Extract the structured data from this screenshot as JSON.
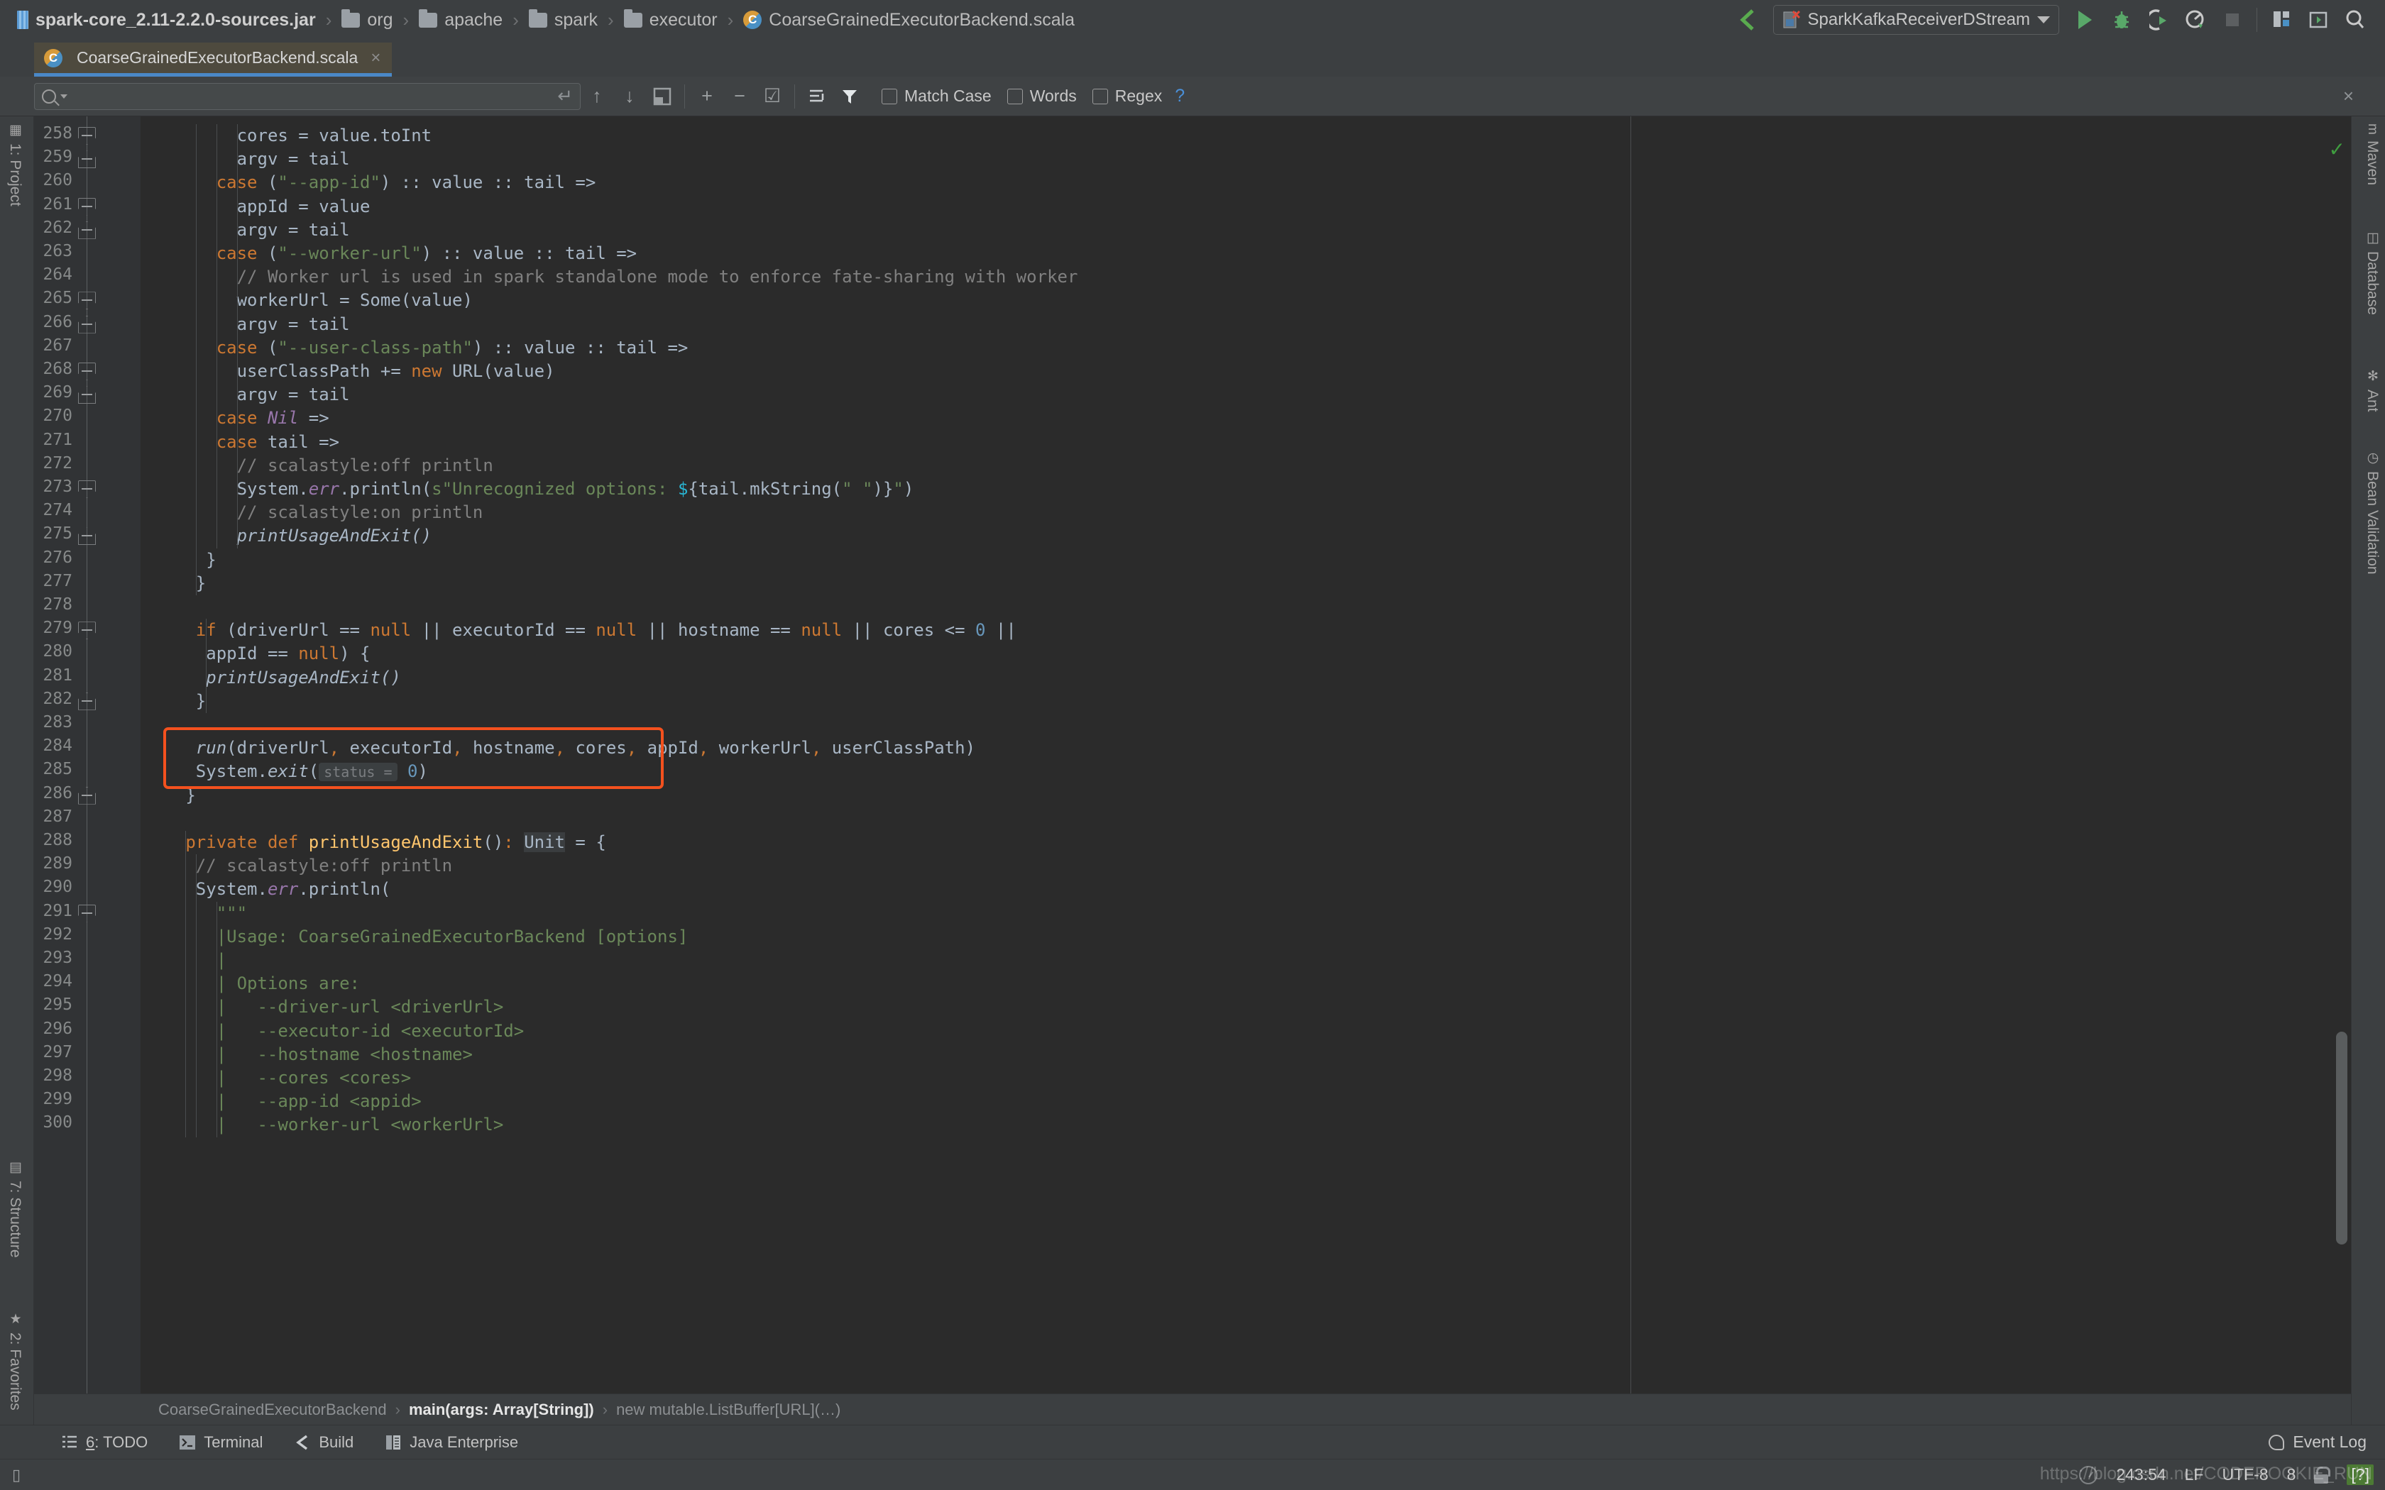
{
  "window": {
    "breadcrumbs": [
      {
        "icon": "jar-icon",
        "label": "spark-core_2.11-2.2.0-sources.jar",
        "bold": true
      },
      {
        "icon": "folder-icon",
        "label": "org",
        "bold": false
      },
      {
        "icon": "folder-icon",
        "label": "apache",
        "bold": false
      },
      {
        "icon": "folder-icon",
        "label": "spark",
        "bold": false
      },
      {
        "icon": "folder-icon",
        "label": "executor",
        "bold": false
      },
      {
        "icon": "scala-file-icon",
        "label": "CoarseGrainedExecutorBackend.scala",
        "bold": false
      }
    ]
  },
  "toolbar": {
    "back_icon": "checkmark-chevron-icon",
    "run_configuration": "SparkKafkaReceiverDStream",
    "icons": [
      {
        "name": "run-icon",
        "glyph": "▶"
      },
      {
        "name": "debug-icon",
        "glyph": "✶"
      },
      {
        "name": "run-with-coverage-icon",
        "glyph": "◗"
      },
      {
        "name": "profile-icon",
        "glyph": "◷"
      },
      {
        "name": "stop-icon",
        "glyph": "■"
      },
      {
        "name": "project-structure-icon",
        "glyph": "▤"
      },
      {
        "name": "terminal-icon",
        "glyph": "▣"
      },
      {
        "name": "search-everywhere-icon",
        "glyph": "⌕"
      }
    ]
  },
  "tabs": [
    {
      "label": "CoarseGrainedExecutorBackend.scala",
      "icon": "scala-file-icon",
      "active": true,
      "close": "×"
    }
  ],
  "find": {
    "value": "",
    "placeholder": "",
    "return_icon": "return-arrow-icon",
    "nav_icons": [
      {
        "name": "find-previous-icon",
        "glyph": "↑"
      },
      {
        "name": "find-next-icon",
        "glyph": "↓"
      },
      {
        "name": "select-all-occurrences-icon",
        "glyph": "◰"
      },
      {
        "name": "add-selection-icon",
        "glyph": "+"
      },
      {
        "name": "remove-selection-icon",
        "glyph": "−"
      },
      {
        "name": "select-occurrences-icon",
        "glyph": "☑"
      },
      {
        "name": "filter-lines-icon",
        "glyph": "≡"
      },
      {
        "name": "filter-icon",
        "glyph": "▼"
      }
    ],
    "options": [
      {
        "label": "Match Case",
        "checked": false
      },
      {
        "label": "Words",
        "checked": false
      },
      {
        "label": "Regex",
        "checked": false
      }
    ],
    "help": "?",
    "close": "×"
  },
  "left_tool_window": [
    {
      "label": "1: Project",
      "icon": "project-icon"
    },
    {
      "label": "7: Structure",
      "icon": "structure-icon"
    },
    {
      "label": "2: Favorites",
      "icon": "favorites-star-icon"
    }
  ],
  "right_tool_window": [
    {
      "label": "Maven",
      "icon": "maven-icon"
    },
    {
      "label": "Database",
      "icon": "database-icon"
    },
    {
      "label": "Ant",
      "icon": "ant-icon"
    },
    {
      "label": "Bean Validation",
      "icon": "bean-validation-icon"
    }
  ],
  "editor": {
    "inspection_status": "ok-checkmark",
    "first_line": 258,
    "highlight_box_lines": [
      284,
      285
    ],
    "lines": [
      {
        "n": 258,
        "indent": 8,
        "tokens": [
          {
            "t": "cores = value.toInt",
            "c": "typ"
          }
        ]
      },
      {
        "n": 259,
        "indent": 8,
        "tokens": [
          {
            "t": "argv = tail",
            "c": "typ"
          }
        ]
      },
      {
        "n": 260,
        "indent": 6,
        "tokens": [
          {
            "t": "case ",
            "c": "kw"
          },
          {
            "t": "(",
            "c": "typ"
          },
          {
            "t": "\"--app-id\"",
            "c": "str"
          },
          {
            "t": ") :: value :: tail =>",
            "c": "typ"
          }
        ]
      },
      {
        "n": 261,
        "indent": 8,
        "tokens": [
          {
            "t": "appId = value",
            "c": "typ"
          }
        ]
      },
      {
        "n": 262,
        "indent": 8,
        "tokens": [
          {
            "t": "argv = tail",
            "c": "typ"
          }
        ]
      },
      {
        "n": 263,
        "indent": 6,
        "tokens": [
          {
            "t": "case ",
            "c": "kw"
          },
          {
            "t": "(",
            "c": "typ"
          },
          {
            "t": "\"--worker-url\"",
            "c": "str"
          },
          {
            "t": ") :: value :: tail =>",
            "c": "typ"
          }
        ]
      },
      {
        "n": 264,
        "indent": 8,
        "tokens": [
          {
            "t": "// Worker url is used in spark standalone mode to enforce fate-sharing with worker",
            "c": "cmt"
          }
        ]
      },
      {
        "n": 265,
        "indent": 8,
        "tokens": [
          {
            "t": "workerUrl = Some(value)",
            "c": "typ"
          }
        ]
      },
      {
        "n": 266,
        "indent": 8,
        "tokens": [
          {
            "t": "argv = tail",
            "c": "typ"
          }
        ]
      },
      {
        "n": 267,
        "indent": 6,
        "tokens": [
          {
            "t": "case ",
            "c": "kw"
          },
          {
            "t": "(",
            "c": "typ"
          },
          {
            "t": "\"--user-class-path\"",
            "c": "str"
          },
          {
            "t": ") :: value :: tail =>",
            "c": "typ"
          }
        ]
      },
      {
        "n": 268,
        "indent": 8,
        "tokens": [
          {
            "t": "userClassPath += ",
            "c": "typ"
          },
          {
            "t": "new ",
            "c": "kw"
          },
          {
            "t": "URL(value)",
            "c": "typ"
          }
        ]
      },
      {
        "n": 269,
        "indent": 8,
        "tokens": [
          {
            "t": "argv = tail",
            "c": "typ"
          }
        ]
      },
      {
        "n": 270,
        "indent": 6,
        "tokens": [
          {
            "t": "case ",
            "c": "kw"
          },
          {
            "t": "Nil",
            "c": "fld"
          },
          {
            "t": " =>",
            "c": "typ"
          }
        ]
      },
      {
        "n": 271,
        "indent": 6,
        "tokens": [
          {
            "t": "case ",
            "c": "kw"
          },
          {
            "t": "tail =>",
            "c": "typ"
          }
        ]
      },
      {
        "n": 272,
        "indent": 8,
        "tokens": [
          {
            "t": "// scalastyle:off println",
            "c": "cmt"
          }
        ]
      },
      {
        "n": 273,
        "indent": 8,
        "tokens": [
          {
            "t": "System.",
            "c": "typ"
          },
          {
            "t": "err",
            "c": "fld"
          },
          {
            "t": ".println(",
            "c": "typ"
          },
          {
            "t": "s\"Unrecognized options: ",
            "c": "str"
          },
          {
            "t": "$",
            "c": "interp"
          },
          {
            "t": "{tail.mkString(",
            "c": "typ"
          },
          {
            "t": "\" \"",
            "c": "str"
          },
          {
            "t": ")}",
            "c": "typ"
          },
          {
            "t": "\"",
            "c": "str"
          },
          {
            "t": ")",
            "c": "typ"
          }
        ]
      },
      {
        "n": 274,
        "indent": 8,
        "tokens": [
          {
            "t": "// scalastyle:on println",
            "c": "cmt"
          }
        ]
      },
      {
        "n": 275,
        "indent": 8,
        "tokens": [
          {
            "t": "printUsageAndExit()",
            "c": "itl"
          }
        ]
      },
      {
        "n": 276,
        "indent": 5,
        "tokens": [
          {
            "t": "}",
            "c": "typ"
          }
        ]
      },
      {
        "n": 277,
        "indent": 4,
        "tokens": [
          {
            "t": "}",
            "c": "typ"
          }
        ]
      },
      {
        "n": 278,
        "indent": 0,
        "tokens": []
      },
      {
        "n": 279,
        "indent": 4,
        "tokens": [
          {
            "t": "if ",
            "c": "kw"
          },
          {
            "t": "(driverUrl == ",
            "c": "typ"
          },
          {
            "t": "null ",
            "c": "kw"
          },
          {
            "t": "|| executorId == ",
            "c": "typ"
          },
          {
            "t": "null ",
            "c": "kw"
          },
          {
            "t": "|| hostname == ",
            "c": "typ"
          },
          {
            "t": "null ",
            "c": "kw"
          },
          {
            "t": "|| cores <= ",
            "c": "typ"
          },
          {
            "t": "0 ",
            "c": "num"
          },
          {
            "t": "||",
            "c": "typ"
          }
        ]
      },
      {
        "n": 280,
        "indent": 5,
        "tokens": [
          {
            "t": "appId == ",
            "c": "typ"
          },
          {
            "t": "null",
            "c": "kw"
          },
          {
            "t": ") {",
            "c": "typ"
          }
        ]
      },
      {
        "n": 281,
        "indent": 5,
        "tokens": [
          {
            "t": "printUsageAndExit()",
            "c": "itl"
          }
        ]
      },
      {
        "n": 282,
        "indent": 4,
        "tokens": [
          {
            "t": "}",
            "c": "typ"
          }
        ]
      },
      {
        "n": 283,
        "indent": 0,
        "tokens": []
      },
      {
        "n": 284,
        "indent": 4,
        "tokens": [
          {
            "t": "run",
            "c": "itl"
          },
          {
            "t": "(driverUrl",
            "c": "typ"
          },
          {
            "t": ",",
            "c": "kw"
          },
          {
            "t": " executorId",
            "c": "typ"
          },
          {
            "t": ",",
            "c": "kw"
          },
          {
            "t": " hostname",
            "c": "typ"
          },
          {
            "t": ",",
            "c": "kw"
          },
          {
            "t": " cores",
            "c": "typ"
          },
          {
            "t": ",",
            "c": "kw"
          },
          {
            "t": " appId",
            "c": "typ"
          },
          {
            "t": ",",
            "c": "kw"
          },
          {
            "t": " workerUrl",
            "c": "typ"
          },
          {
            "t": ",",
            "c": "kw"
          },
          {
            "t": " userClassPath)",
            "c": "typ"
          }
        ]
      },
      {
        "n": 285,
        "indent": 4,
        "tokens": [
          {
            "t": "System.",
            "c": "typ"
          },
          {
            "t": "exit",
            "c": "itl"
          },
          {
            "t": "(",
            "c": "typ"
          },
          {
            "t": "status =",
            "c": "hint"
          },
          {
            "t": " ",
            "c": "typ"
          },
          {
            "t": "0",
            "c": "num"
          },
          {
            "t": ")",
            "c": "typ"
          }
        ]
      },
      {
        "n": 286,
        "indent": 3,
        "tokens": [
          {
            "t": "}",
            "c": "typ"
          }
        ]
      },
      {
        "n": 287,
        "indent": 0,
        "tokens": []
      },
      {
        "n": 288,
        "indent": 3,
        "tokens": [
          {
            "t": "private def ",
            "c": "kw"
          },
          {
            "t": "printUsageAndExit",
            "c": "fn"
          },
          {
            "t": "()",
            "c": "typ"
          },
          {
            "t": ":",
            "c": "kw"
          },
          {
            "t": " ",
            "c": "typ"
          },
          {
            "t": "Unit",
            "c": "ulbg"
          },
          {
            "t": " = {",
            "c": "typ"
          }
        ]
      },
      {
        "n": 289,
        "indent": 4,
        "tokens": [
          {
            "t": "// scalastyle:off println",
            "c": "cmt"
          }
        ]
      },
      {
        "n": 290,
        "indent": 4,
        "tokens": [
          {
            "t": "System.",
            "c": "typ"
          },
          {
            "t": "err",
            "c": "fld"
          },
          {
            "t": ".println(",
            "c": "typ"
          }
        ]
      },
      {
        "n": 291,
        "indent": 6,
        "tokens": [
          {
            "t": "\"\"\"",
            "c": "str"
          }
        ]
      },
      {
        "n": 292,
        "indent": 6,
        "tokens": [
          {
            "t": "|Usage: CoarseGrainedExecutorBackend [options]",
            "c": "str"
          }
        ]
      },
      {
        "n": 293,
        "indent": 6,
        "tokens": [
          {
            "t": "|",
            "c": "str"
          }
        ]
      },
      {
        "n": 294,
        "indent": 6,
        "tokens": [
          {
            "t": "| Options are:",
            "c": "str"
          }
        ]
      },
      {
        "n": 295,
        "indent": 6,
        "tokens": [
          {
            "t": "|   --driver-url <driverUrl>",
            "c": "str"
          }
        ]
      },
      {
        "n": 296,
        "indent": 6,
        "tokens": [
          {
            "t": "|   --executor-id <executorId>",
            "c": "str"
          }
        ]
      },
      {
        "n": 297,
        "indent": 6,
        "tokens": [
          {
            "t": "|   --hostname <hostname>",
            "c": "str"
          }
        ]
      },
      {
        "n": 298,
        "indent": 6,
        "tokens": [
          {
            "t": "|   --cores <cores>",
            "c": "str"
          }
        ]
      },
      {
        "n": 299,
        "indent": 6,
        "tokens": [
          {
            "t": "|   --app-id <appid>",
            "c": "str"
          }
        ]
      },
      {
        "n": 300,
        "indent": 6,
        "tokens": [
          {
            "t": "|   --worker-url <workerUrl>",
            "c": "str"
          }
        ]
      }
    ],
    "fold_markers": [
      {
        "line": 258,
        "type": "top"
      },
      {
        "line": 259,
        "type": "bot"
      },
      {
        "line": 261,
        "type": "top"
      },
      {
        "line": 262,
        "type": "bot"
      },
      {
        "line": 265,
        "type": "top"
      },
      {
        "line": 266,
        "type": "bot"
      },
      {
        "line": 268,
        "type": "top"
      },
      {
        "line": 269,
        "type": "bot"
      },
      {
        "line": 273,
        "type": "top"
      },
      {
        "line": 275,
        "type": "bot"
      },
      {
        "line": 279,
        "type": "top"
      },
      {
        "line": 282,
        "type": "bot"
      },
      {
        "line": 286,
        "type": "bot"
      },
      {
        "line": 291,
        "type": "top"
      }
    ]
  },
  "editor_breadcrumb": [
    {
      "label": "CoarseGrainedExecutorBackend",
      "active": false
    },
    {
      "label": "main(args: Array[String])",
      "active": true
    },
    {
      "label": "new mutable.ListBuffer[URL](…)",
      "active": false
    }
  ],
  "bottom_tabs": [
    {
      "num": "6",
      "label": ": TODO",
      "icon": "todo-list-icon"
    },
    {
      "num": "",
      "label": "Terminal",
      "icon": "terminal-icon"
    },
    {
      "num": "",
      "label": "Build",
      "icon": "build-hammer-icon"
    },
    {
      "num": "",
      "label": "Java Enterprise",
      "icon": "java-enterprise-icon"
    }
  ],
  "event_log": {
    "label": "Event Log",
    "icon": "event-log-icon"
  },
  "statusbar": {
    "left_icon": "memory-indicator-icon",
    "caret_position": "243:54",
    "line_separator": "LF",
    "encoding": "UTF-8",
    "indent": "8",
    "lock_icon": "read-only-lock-icon",
    "context_badge": "[?]",
    "gauge_icon": "inspection-gauge-icon",
    "watermark": "https://blog.csdn.net/CODEROOKIE_RUN"
  }
}
